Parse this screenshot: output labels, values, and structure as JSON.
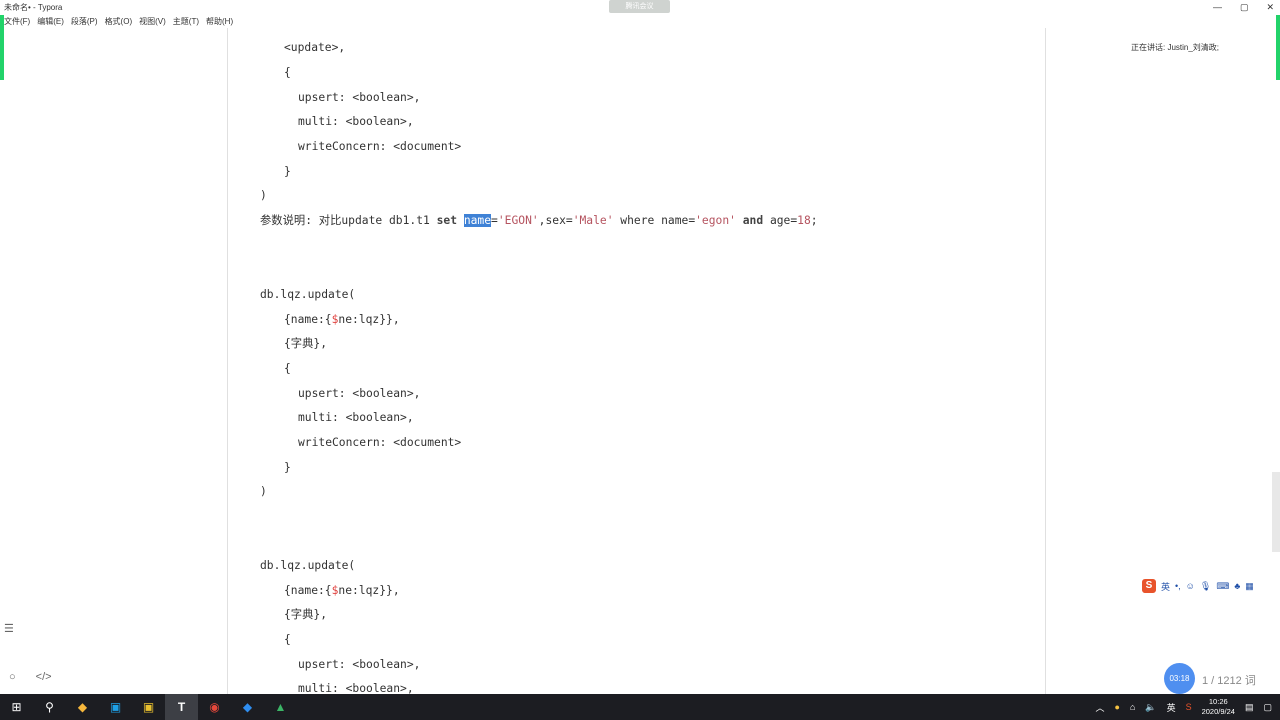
{
  "window": {
    "title": "未命名• - Typora",
    "meeting_label": "腾讯会议",
    "controls": [
      "—",
      "▢",
      "✕"
    ]
  },
  "menu": [
    "文件(F)",
    "编辑(E)",
    "段落(P)",
    "格式(O)",
    "视图(V)",
    "主题(T)",
    "帮助(H)"
  ],
  "meeting": {
    "speaking": "正在讲话: Justin_刘清政;"
  },
  "code": {
    "l1": "<update>,",
    "l2": "{",
    "l3": "upsert: <boolean>,",
    "l4": "multi: <boolean>,",
    "l5": "writeConcern: <document>",
    "l6": "}",
    "l7": ")",
    "note_prefix": "参数说明: 对比update db1.t1 ",
    "note_set": "set",
    "note_name": "name",
    "note_eq1": "=",
    "note_egon1": "'EGON'",
    "note_mid": ",sex=",
    "note_male": "'Male'",
    "note_where": " where name=",
    "note_egon2": "'egon'",
    "note_and": "and",
    "note_age": " age=",
    "note_18": "18",
    "note_end": ";",
    "b1_head": "db.lqz.update(",
    "b1_q_a": "{name:{",
    "b1_q_b": "$",
    "b1_q_c": "ne:lqz}},",
    "b1_dict": "{字典},",
    "b1_open": "{",
    "b1_upsert": "upsert: <boolean>,",
    "b1_multi": "multi: <boolean>,",
    "b1_wc": "writeConcern: <document>",
    "b1_close": "}",
    "b1_end": ")",
    "b2_head": "db.lqz.update(",
    "b2_q_a": "{name:{",
    "b2_q_b": "$",
    "b2_q_c": "ne:lqz}},",
    "b2_dict": "{字典},",
    "b2_open": "{",
    "b2_upsert": "upsert: <boolean>,",
    "b2_multi": "multi: <boolean>,"
  },
  "ime": {
    "lang": "英"
  },
  "status": {
    "timer": "03:18",
    "word_count": "1 / 1212 词"
  },
  "taskbar": {
    "clock_time": "10:26",
    "clock_date": "2020/9/24",
    "ime_lang": "英"
  },
  "colors": {
    "accent_green": "#22d36a",
    "selection": "#3f82d6",
    "string": "#b5535f"
  }
}
